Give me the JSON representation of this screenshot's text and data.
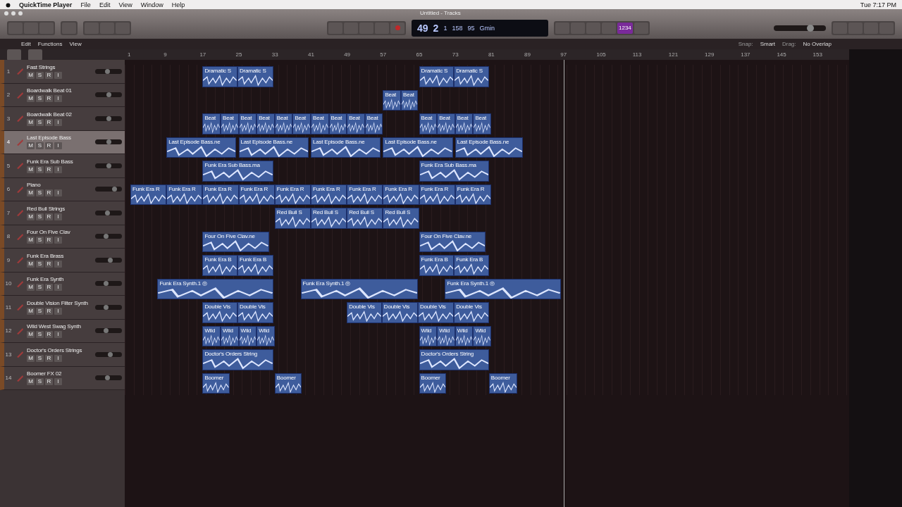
{
  "menubar": {
    "app": "QuickTime Player",
    "menus": [
      "File",
      "Edit",
      "View",
      "Window",
      "Help"
    ],
    "clock": "Tue 7:17 PM"
  },
  "window": {
    "title": "Untitled - Tracks"
  },
  "lcd": {
    "bar": "49",
    "beat": "2",
    "div": "1",
    "tempo": "158",
    "tick": "95",
    "key": "Gmin"
  },
  "toolbar": {
    "cycle_on": false,
    "count_in_on": true,
    "count_in_label": "1234",
    "master_volume": {
      "level": 0.7
    }
  },
  "control_bar": {
    "menus": [
      "Edit",
      "Functions",
      "View"
    ],
    "snap_label": "Snap:",
    "snap": "Smart",
    "drag_label": "Drag:",
    "drag": "No Overlap"
  },
  "ruler": [
    "1",
    "9",
    "17",
    "25",
    "33",
    "41",
    "49",
    "57",
    "65",
    "73",
    "81",
    "89",
    "97",
    "105",
    "113",
    "121",
    "129",
    "137",
    "145",
    "153"
  ],
  "tracks": [
    {
      "number": "1",
      "name": "Fast Strings",
      "selected": false,
      "buttons": [
        "M",
        "S",
        "R",
        "I"
      ],
      "level": 0.45,
      "regions": [
        "Dramatic S",
        "Dramatic S",
        "Dramatic S",
        "Dramatic S"
      ]
    },
    {
      "number": "2",
      "name": "Boardwalk Beat 01",
      "selected": false,
      "buttons": [
        "M",
        "S",
        "R",
        "I"
      ],
      "level": 0.5,
      "regions": [
        "Beat",
        "Beat"
      ]
    },
    {
      "number": "3",
      "name": "Boardwalk Beat 02",
      "selected": false,
      "buttons": [
        "M",
        "S",
        "R",
        "I"
      ],
      "level": 0.5,
      "regions": [
        "Beat",
        "Beat",
        "Beat",
        "Beat",
        "Beat",
        "Beat",
        "Beat",
        "Beat",
        "Beat",
        "Beat",
        "Beat",
        "Beat",
        "Beat",
        "Beat"
      ]
    },
    {
      "number": "4",
      "name": "Last Episode Bass",
      "selected": true,
      "buttons": [
        "M",
        "S",
        "R",
        "I"
      ],
      "level": 0.5,
      "regions": [
        "Last Episode Bass.ne",
        "Last Episode Bass.ne",
        "Last Episode Bass.ne",
        "Last Episode Bass.ne",
        "Last Episode Bass.ne"
      ]
    },
    {
      "number": "5",
      "name": "Funk Era Sub Bass",
      "selected": false,
      "buttons": [
        "M",
        "S",
        "R",
        "I"
      ],
      "level": 0.5,
      "regions": [
        "Funk Era Sub Bass.ma",
        "Funk Era Sub Bass.ma"
      ]
    },
    {
      "number": "6",
      "name": "Piano",
      "selected": false,
      "buttons": [
        "M",
        "S",
        "R",
        "I"
      ],
      "level": 0.7,
      "regions": [
        "Funk Era R",
        "Funk Era R",
        "Funk Era R",
        "Funk Era R",
        "Funk Era R",
        "Funk Era R",
        "Funk Era R",
        "Funk Era R",
        "Funk Era R",
        "Funk Era R"
      ]
    },
    {
      "number": "7",
      "name": "Red Bull Strings",
      "selected": false,
      "buttons": [
        "M",
        "S",
        "R",
        "I"
      ],
      "level": 0.45,
      "regions": [
        "Red Bull S",
        "Red Bull S",
        "Red Bull S",
        "Red Bull S"
      ]
    },
    {
      "number": "8",
      "name": "Four On Five Clav",
      "selected": false,
      "buttons": [
        "M",
        "S",
        "R",
        "I"
      ],
      "level": 0.4,
      "regions": [
        "Four On Five Clav.ne",
        "Four On Five Clav.ne"
      ]
    },
    {
      "number": "9",
      "name": "Funk Era Brass",
      "selected": false,
      "buttons": [
        "M",
        "S",
        "R",
        "I"
      ],
      "level": 0.55,
      "regions": [
        "Funk Era B",
        "Funk Era B",
        "Funk Era B",
        "Funk Era B"
      ]
    },
    {
      "number": "10",
      "name": "Funk Era Synth",
      "selected": false,
      "buttons": [
        "M",
        "S",
        "R",
        "I"
      ],
      "level": 0.4,
      "regions": [
        "Funk Era Synth.1 ◎",
        "Funk Era Synth.1 ◎",
        "Funk Era Synth.1 ◎"
      ]
    },
    {
      "number": "11",
      "name": "Double Vision Filter Synth",
      "selected": false,
      "buttons": [
        "M",
        "S",
        "R",
        "I"
      ],
      "level": 0.4,
      "regions": [
        "Double Vis",
        "Double Vis",
        "Double Vis",
        "Double Vis",
        "Double Vis",
        "Double Vis"
      ]
    },
    {
      "number": "12",
      "name": "Wild West Swag Synth",
      "selected": false,
      "buttons": [
        "M",
        "S",
        "R",
        "I"
      ],
      "level": 0.4,
      "regions": [
        "Wild",
        "Wild",
        "Wild",
        "Wild",
        "Wild",
        "Wild",
        "Wild",
        "Wild"
      ]
    },
    {
      "number": "13",
      "name": "Doctor's Orders Strings",
      "selected": false,
      "buttons": [
        "M",
        "S",
        "R",
        "I"
      ],
      "level": 0.55,
      "regions": [
        "Doctor's Orders String",
        "Doctor's Orders String"
      ]
    },
    {
      "number": "14",
      "name": "Boomer FX 02",
      "selected": false,
      "buttons": [
        "M",
        "S",
        "R",
        "I"
      ],
      "level": 0.45,
      "regions": [
        "Boomer",
        "Boomer",
        "Boomer",
        "Boomer"
      ]
    }
  ]
}
